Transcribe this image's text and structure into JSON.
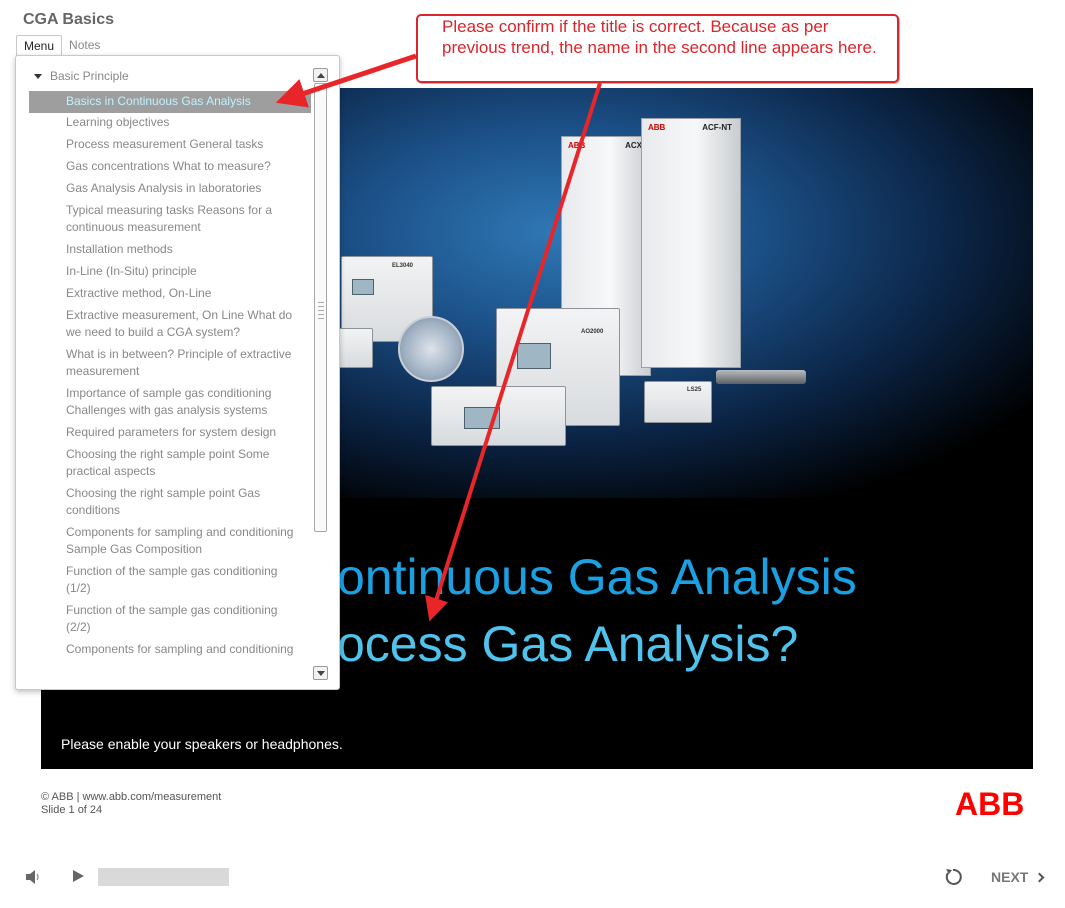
{
  "app": {
    "title": "CGA Basics"
  },
  "tabs": [
    {
      "label": "Menu",
      "active": true
    },
    {
      "label": "Notes",
      "active": false
    }
  ],
  "menu": {
    "section": "Basic Principle",
    "items": [
      {
        "label": "Basics in Continuous Gas Analysis",
        "current": true
      },
      {
        "label": "Learning objectives"
      },
      {
        "label": "Process measurement General tasks"
      },
      {
        "label": "Gas concentrations What to measure?"
      },
      {
        "label": "Gas Analysis Analysis in laboratories"
      },
      {
        "label": "Typical measuring tasks Reasons for a continuous measurement"
      },
      {
        "label": "Installation methods"
      },
      {
        "label": "In-Line (In-Situ) principle"
      },
      {
        "label": "Extractive method, On-Line"
      },
      {
        "label": "Extractive measurement, On Line What do we need to build a CGA system?"
      },
      {
        "label": "What is in between? Principle of extractive measurement"
      },
      {
        "label": "Importance of sample gas conditioning Challenges with gas analysis systems"
      },
      {
        "label": "Required parameters for system design"
      },
      {
        "label": "Choosing the right sample point Some practical aspects"
      },
      {
        "label": "Choosing the right sample point Gas conditions"
      },
      {
        "label": "Components for sampling and conditioning Sample Gas Composition"
      },
      {
        "label": "Function of the sample gas conditioning (1/2)"
      },
      {
        "label": "Function of the sample gas conditioning (2/2)"
      },
      {
        "label": "Components for sampling and conditioning"
      }
    ]
  },
  "slide": {
    "heading_line1": "ontinuous Gas Analysis",
    "heading_line2": "ocess Gas Analysis?",
    "speaker_note": "Please enable your speakers or headphones.",
    "products": {
      "cabinet_left_brand": "ABB",
      "cabinet_left_model": "ACX",
      "cabinet_right_brand": "ABB",
      "cabinet_right_model": "ACF-NT",
      "device_el3040": "EL3040",
      "device_ao2000": "AO2000",
      "device_ls25": "LS25"
    }
  },
  "annotation": {
    "text": "Please confirm if the title is correct. Because as per previous trend, the name in the second line appears here.",
    "color": "#d8262c"
  },
  "footer": {
    "copyright": "© ABB | www.abb.com/measurement",
    "slide_counter": "Slide 1 of 24",
    "logo": "ABB",
    "logo_color": "#ff0000"
  },
  "controls": {
    "next_label": "NEXT",
    "progress": 0
  },
  "icons": [
    "speaker-icon",
    "play-icon",
    "replay-icon",
    "chevron-right-icon",
    "triangle-down-icon",
    "scroll-up-icon",
    "scroll-down-icon"
  ]
}
